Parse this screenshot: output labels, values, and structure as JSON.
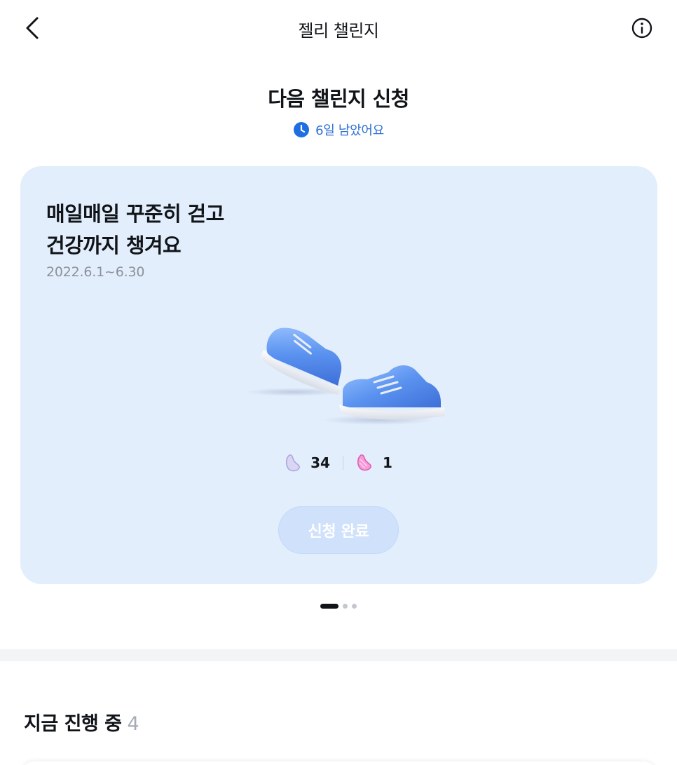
{
  "header": {
    "title": "젤리 챌린지",
    "back_icon": "chevron-left-icon",
    "info_icon": "info-icon"
  },
  "next_challenge": {
    "heading": "다음 챌린지 신청",
    "remaining_icon": "clock-icon",
    "remaining_text": "6일 남았어요",
    "accent_color": "#2f6fd6"
  },
  "card": {
    "title_line1": "매일매일 꾸준히 걷고",
    "title_line2": "건강까지 챙겨요",
    "date_range": "2022.6.1~6.30",
    "image_icon": "sneakers-icon",
    "rewards": [
      {
        "icon": "purple-jelly-icon",
        "value": "34"
      },
      {
        "icon": "pink-jelly-icon",
        "value": "1"
      }
    ],
    "button_label": "신청 완료",
    "button_state": "disabled",
    "background_color": "#e3eefc"
  },
  "pager": {
    "total": 3,
    "active": 1
  },
  "ongoing": {
    "label": "지금 진행 중",
    "count": "4"
  }
}
